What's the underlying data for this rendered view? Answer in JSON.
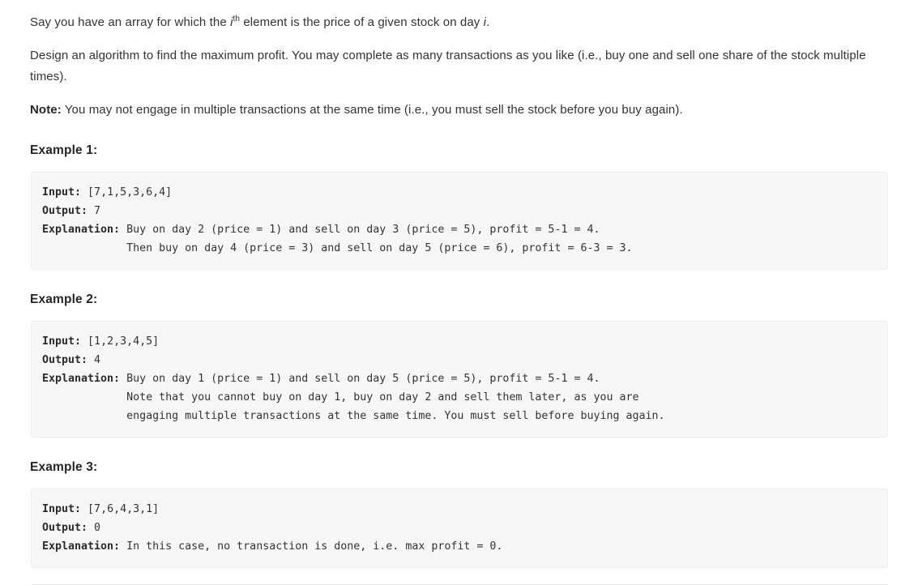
{
  "problem": {
    "paragraphs": [
      {
        "id": "statement-array",
        "before": "Say you have an array for which the ",
        "var": "i",
        "sup": "th",
        "after": " element is the price of a given stock on day ",
        "var2": "i",
        "end": "."
      },
      {
        "id": "statement-design",
        "text": "Design an algorithm to find the maximum profit. You may complete as many transactions as you like (i.e., buy one and sell one share of the stock multiple times)."
      }
    ],
    "note": {
      "label": "Note:",
      "text": " You may not engage in multiple transactions at the same time (i.e., you must sell the stock before you buy again)."
    }
  },
  "examples": [
    {
      "heading": "Example 1:",
      "input_label": "Input:",
      "input_value": " [7,1,5,3,6,4]",
      "output_label": "Output:",
      "output_value": " 7",
      "explanation_label": "Explanation:",
      "explanation_value": " Buy on day 2 (price = 1) and sell on day 3 (price = 5), profit = 5-1 = 4.\n             Then buy on day 4 (price = 3) and sell on day 5 (price = 6), profit = 6-3 = 3."
    },
    {
      "heading": "Example 2:",
      "input_label": "Input:",
      "input_value": " [1,2,3,4,5]",
      "output_label": "Output:",
      "output_value": " 4",
      "explanation_label": "Explanation:",
      "explanation_value": " Buy on day 1 (price = 1) and sell on day 5 (price = 5), profit = 5-1 = 4.\n             Note that you cannot buy on day 1, buy on day 2 and sell them later, as you are\n             engaging multiple transactions at the same time. You must sell before buying again."
    },
    {
      "heading": "Example 3:",
      "input_label": "Input:",
      "input_value": " [7,6,4,3,1]",
      "output_label": "Output:",
      "output_value": " 0",
      "explanation_label": "Explanation:",
      "explanation_value": " In this case, no transaction is done, i.e. max profit = 0."
    }
  ],
  "colors": {
    "text": "#333333",
    "heading": "#262626",
    "code_background": "#f7f7f7",
    "code_border": "#eceeef",
    "divider": "#e7e7e7"
  }
}
